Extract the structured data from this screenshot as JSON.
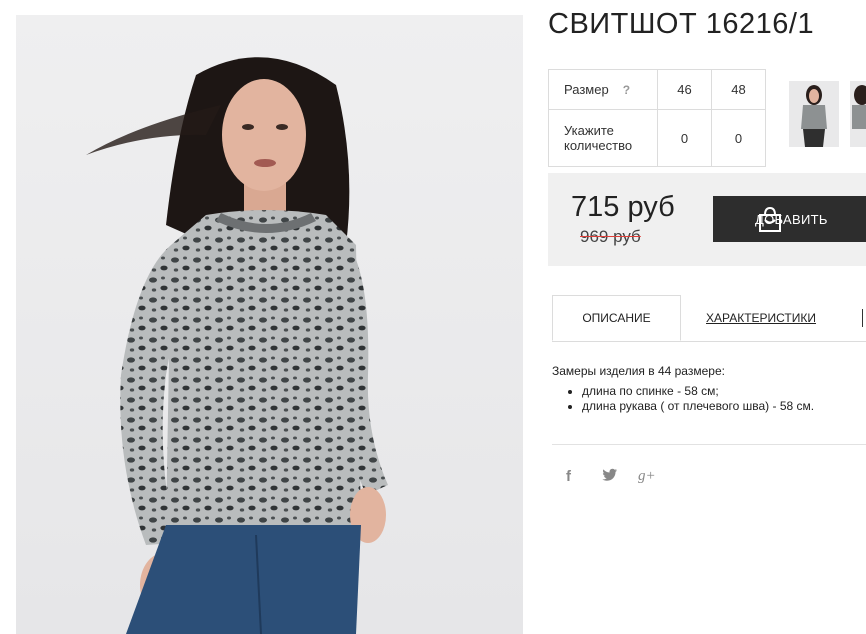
{
  "product": {
    "title": "СВИТШОТ 16216/1",
    "image_alt": "leopard print sweatshirt worn by model"
  },
  "sizes": {
    "size_label": "Размер",
    "help_symbol": "?",
    "quantity_label": "Укажите количество",
    "columns": [
      {
        "size": "46",
        "quantity": "0"
      },
      {
        "size": "48",
        "quantity": "0"
      }
    ]
  },
  "pricing": {
    "price": "715 руб",
    "old_price": "969 руб",
    "add_button_label": "ДОБАВИТЬ"
  },
  "tabs": [
    {
      "label": "ОПИСАНИЕ",
      "active": true
    },
    {
      "label": "ХАРАКТЕРИСТИКИ",
      "active": false
    }
  ],
  "description": {
    "intro": "Замеры изделия в 44 размере:",
    "items": [
      "длина по спинке - 58 см;",
      "длина рукава ( от плечевого шва) - 58 см."
    ]
  },
  "social": {
    "facebook": "f",
    "twitter": "t",
    "google": "g+"
  },
  "colors": {
    "price_box_bg": "#f0f0f0",
    "button_bg": "#2d2d2d",
    "strike_color": "#e0403a"
  },
  "icons": [
    "shopping-bag-icon",
    "facebook-icon",
    "twitter-icon",
    "google-plus-icon",
    "help-icon"
  ]
}
